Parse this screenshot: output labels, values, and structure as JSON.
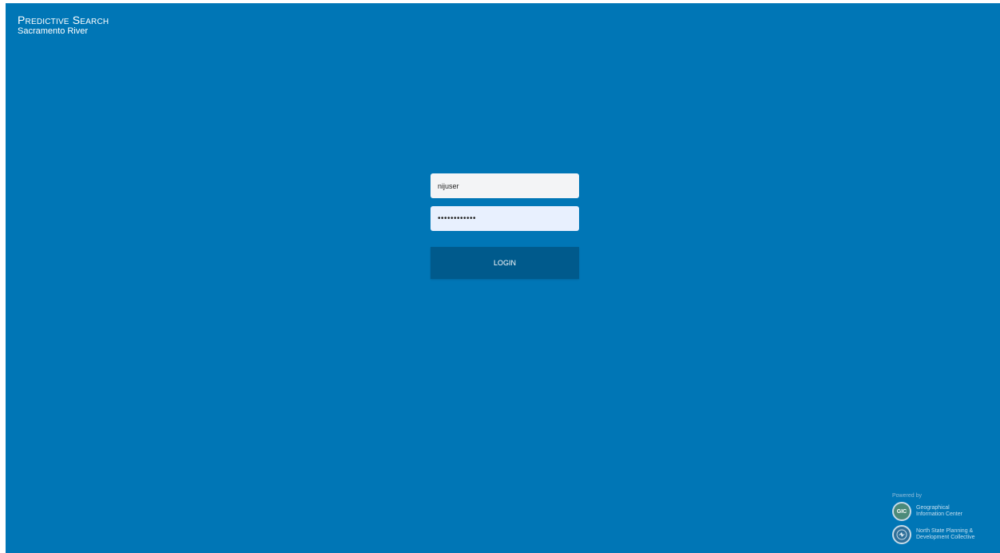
{
  "header": {
    "title": "Predictive Search",
    "subtitle": "Sacramento River"
  },
  "login": {
    "username_value": "nijuser",
    "password_value": "••••••••••••",
    "button_label": "LOGIN"
  },
  "footer": {
    "powered_by": "Powered by",
    "brands": [
      {
        "badge": "GIC",
        "line1": "Geographical",
        "line2": "Information Center",
        "icon": "gic-logo-icon"
      },
      {
        "line1": "North State Planning &",
        "line2": "Development Collective",
        "icon": "nspdc-logo-icon"
      }
    ]
  },
  "colors": {
    "background": "#0076b6",
    "button": "#005a8c",
    "text": "#ffffff"
  }
}
